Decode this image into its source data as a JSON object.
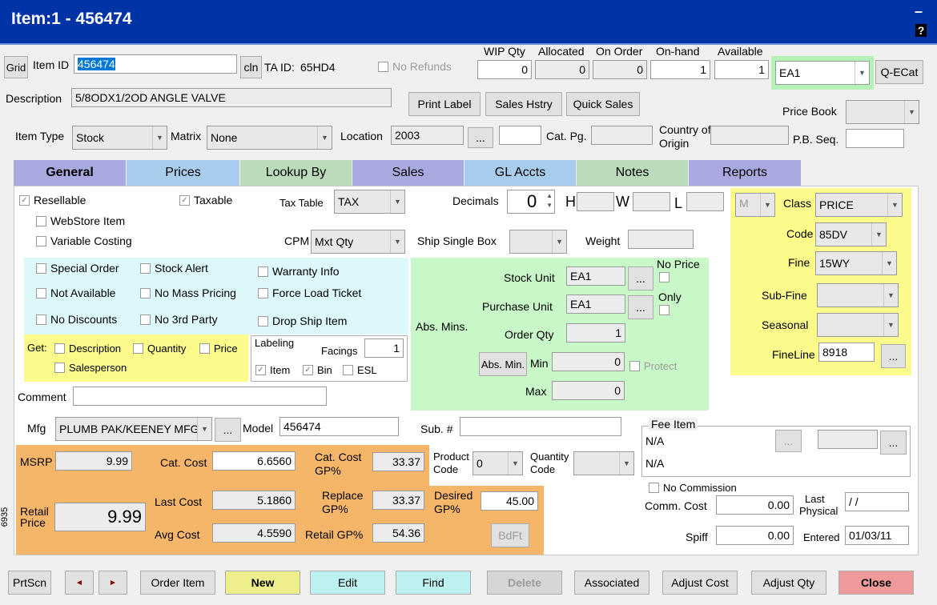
{
  "window": {
    "title": "Item:1 - 456474",
    "minimize": "–",
    "help": "?"
  },
  "top": {
    "grid": "Grid",
    "item_id_label": "Item ID",
    "item_id": "456474",
    "cln": "cln",
    "ta_id_label": "TA ID:",
    "ta_id": "65HD4",
    "no_refunds": "No Refunds",
    "qty_headers": [
      "WIP Qty",
      "Allocated",
      "On Order",
      "On-hand",
      "Available"
    ],
    "qty_values": [
      "0",
      "0",
      "0",
      "1",
      "1"
    ],
    "unit_select": "EA1",
    "qecat": "Q-ECat",
    "description_label": "Description",
    "description": "5/8ODX1/2OD ANGLE VALVE",
    "print_label": "Print Label",
    "sales_hstry": "Sales Hstry",
    "quick_sales": "Quick Sales",
    "price_book_label": "Price Book",
    "item_type_label": "Item Type",
    "item_type": "Stock",
    "matrix_label": "Matrix",
    "matrix": "None",
    "location_label": "Location",
    "location": "2003",
    "location_btn": "...",
    "cat_pg_label": "Cat. Pg.",
    "country_label_1": "Country of",
    "country_label_2": "Origin",
    "pb_seq_label": "P.B. Seq."
  },
  "tabs": [
    "General",
    "Prices",
    "Lookup By",
    "Sales",
    "GL Accts",
    "Notes",
    "Reports"
  ],
  "general": {
    "resellable": "Resellable",
    "taxable": "Taxable",
    "tax_table_label": "Tax Table",
    "tax_table": "TAX",
    "decimals_label": "Decimals",
    "decimals": "0",
    "h": "H",
    "w": "W",
    "l": "L",
    "webstore": "WebStore Item",
    "variable_costing": "Variable Costing",
    "cpm_label": "CPM",
    "cpm": "Mxt Qty",
    "ship_single_box": "Ship Single Box",
    "weight": "Weight",
    "special_order": "Special Order",
    "stock_alert": "Stock Alert",
    "warranty_info": "Warranty Info",
    "not_available": "Not Available",
    "no_mass_pricing": "No Mass Pricing",
    "force_load_ticket": "Force Load Ticket",
    "no_discounts": "No Discounts",
    "no_3rd_party": "No 3rd Party",
    "drop_ship_item": "Drop Ship Item",
    "get_label": "Get:",
    "get_description": "Description",
    "get_quantity": "Quantity",
    "get_price": "Price",
    "get_salesperson": "Salesperson",
    "labeling": "Labeling",
    "facings_label": "Facings",
    "facings": "1",
    "label_item": "Item",
    "label_bin": "Bin",
    "label_esl": "ESL",
    "comment_label": "Comment",
    "stock_unit_label": "Stock Unit",
    "stock_unit": "EA1",
    "purchase_unit_label": "Purchase Unit",
    "purchase_unit": "EA1",
    "abs_mins_label": "Abs. Mins.",
    "order_qty_label": "Order Qty",
    "order_qty": "1",
    "abs_min_btn": "Abs. Min.",
    "min_label": "Min",
    "min": "0",
    "protect": "Protect",
    "max_label": "Max",
    "max": "0",
    "no_price": "No Price",
    "only": "Only",
    "dots": "...",
    "class_sel": "M",
    "class_label": "Class",
    "class": "PRICE",
    "code_label": "Code",
    "code": "85DV",
    "fine_label": "Fine",
    "fine": "15WY",
    "subfine_label": "Sub-Fine",
    "seasonal_label": "Seasonal",
    "fineline_label": "FineLine",
    "fineline": "8918",
    "mfg_label": "Mfg",
    "mfg": "PLUMB PAK/KEENEY MFG",
    "model_label": "Model",
    "model": "456474",
    "sub_label": "Sub. #",
    "fee_item_label": "Fee Item",
    "fee_1": "N/A",
    "fee_2": "N/A",
    "msrp_label": "MSRP",
    "msrp": "9.99",
    "retail_label_1": "Retail",
    "retail_label_2": "Price",
    "retail": "9.99",
    "cat_cost_label": "Cat. Cost",
    "cat_cost": "6.6560",
    "cat_gp_label_1": "Cat. Cost",
    "cat_gp_label_2": "GP%",
    "cat_gp": "33.37",
    "last_cost_label": "Last Cost",
    "last_cost": "5.1860",
    "replace_label_1": "Replace",
    "replace_label_2": "GP%",
    "replace_gp": "33.37",
    "avg_cost_label": "Avg Cost",
    "avg_cost": "4.5590",
    "retail_gp_label": "Retail GP%",
    "retail_gp": "54.36",
    "product_code_label_1": "Product",
    "product_code_label_2": "Code",
    "product_code": "0",
    "qty_code_label_1": "Quantity",
    "qty_code_label_2": "Code",
    "desired_label_1": "Desired",
    "desired_label_2": "GP%",
    "desired_gp": "45.00",
    "bdft": "BdFt",
    "no_commission": "No Commission",
    "comm_cost_label": "Comm. Cost",
    "comm_cost": "0.00",
    "last_physical_1": "Last",
    "last_physical_2": "Physical",
    "last_physical": "/ /",
    "spiff_label": "Spiff",
    "spiff": "0.00",
    "entered_label": "Entered",
    "entered": "01/03/11",
    "side_number": "6935"
  },
  "bottom": {
    "prtscn": "PrtScn",
    "prev": "◄",
    "next": "►",
    "order_item": "Order Item",
    "new": "New",
    "edit": "Edit",
    "find": "Find",
    "delete": "Delete",
    "associated": "Associated",
    "adjust_cost": "Adjust Cost",
    "adjust_qty": "Adjust Qty",
    "close": "Close"
  },
  "colors": {
    "title_bar": "#0033a6",
    "tab_general": "#a9a9e0",
    "tab_prices": "#a8ccec",
    "tab_lookup": "#bbdcbb",
    "tab_notes": "#bbdcbb",
    "tab_reports": "#a9a9e0",
    "cyan_panel": "#dcf8fb",
    "yellow_panel": "#fbfb8c",
    "green_panel": "#c8f7c8",
    "orange_panel": "#f5b66a",
    "new_btn": "#eeee8a",
    "edit_btn": "#bdf0f0",
    "close_btn": "#ef9a9a"
  }
}
